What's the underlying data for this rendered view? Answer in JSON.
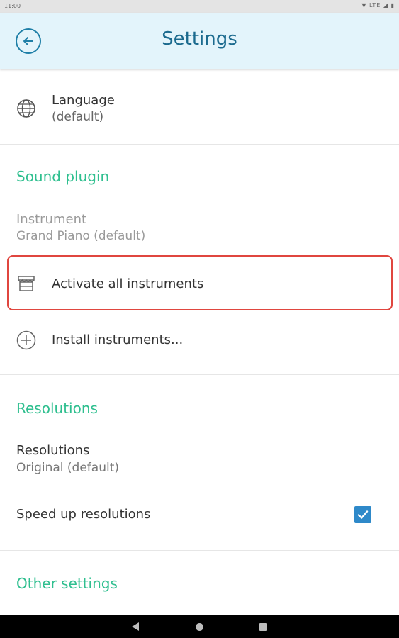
{
  "status_bar": {
    "time": "11:00",
    "indicators": "▼ LTE ◢ ▮"
  },
  "app_bar": {
    "title": "Settings",
    "back_icon": "arrow-left-circle-icon"
  },
  "language": {
    "label": "Language",
    "value": "(default)",
    "icon": "globe-icon"
  },
  "sound_plugin": {
    "section_title": "Sound plugin",
    "instrument_label": "Instrument",
    "instrument_value": "Grand Piano (default)",
    "activate_label": "Activate all instruments",
    "activate_icon": "store-icon",
    "install_label": "Install instruments...",
    "install_icon": "plus-circle-icon"
  },
  "resolutions": {
    "section_title": "Resolutions",
    "label": "Resolutions",
    "value": "Original (default)",
    "speed_up_label": "Speed up resolutions",
    "speed_up_checked": true
  },
  "other": {
    "section_title": "Other settings"
  },
  "colors": {
    "accent_green": "#2fbf8f",
    "title_blue": "#1b6a8e",
    "appbar_bg": "#e3f4fb",
    "highlight_red": "#e0463f",
    "checkbox_blue": "#2e89c9"
  }
}
